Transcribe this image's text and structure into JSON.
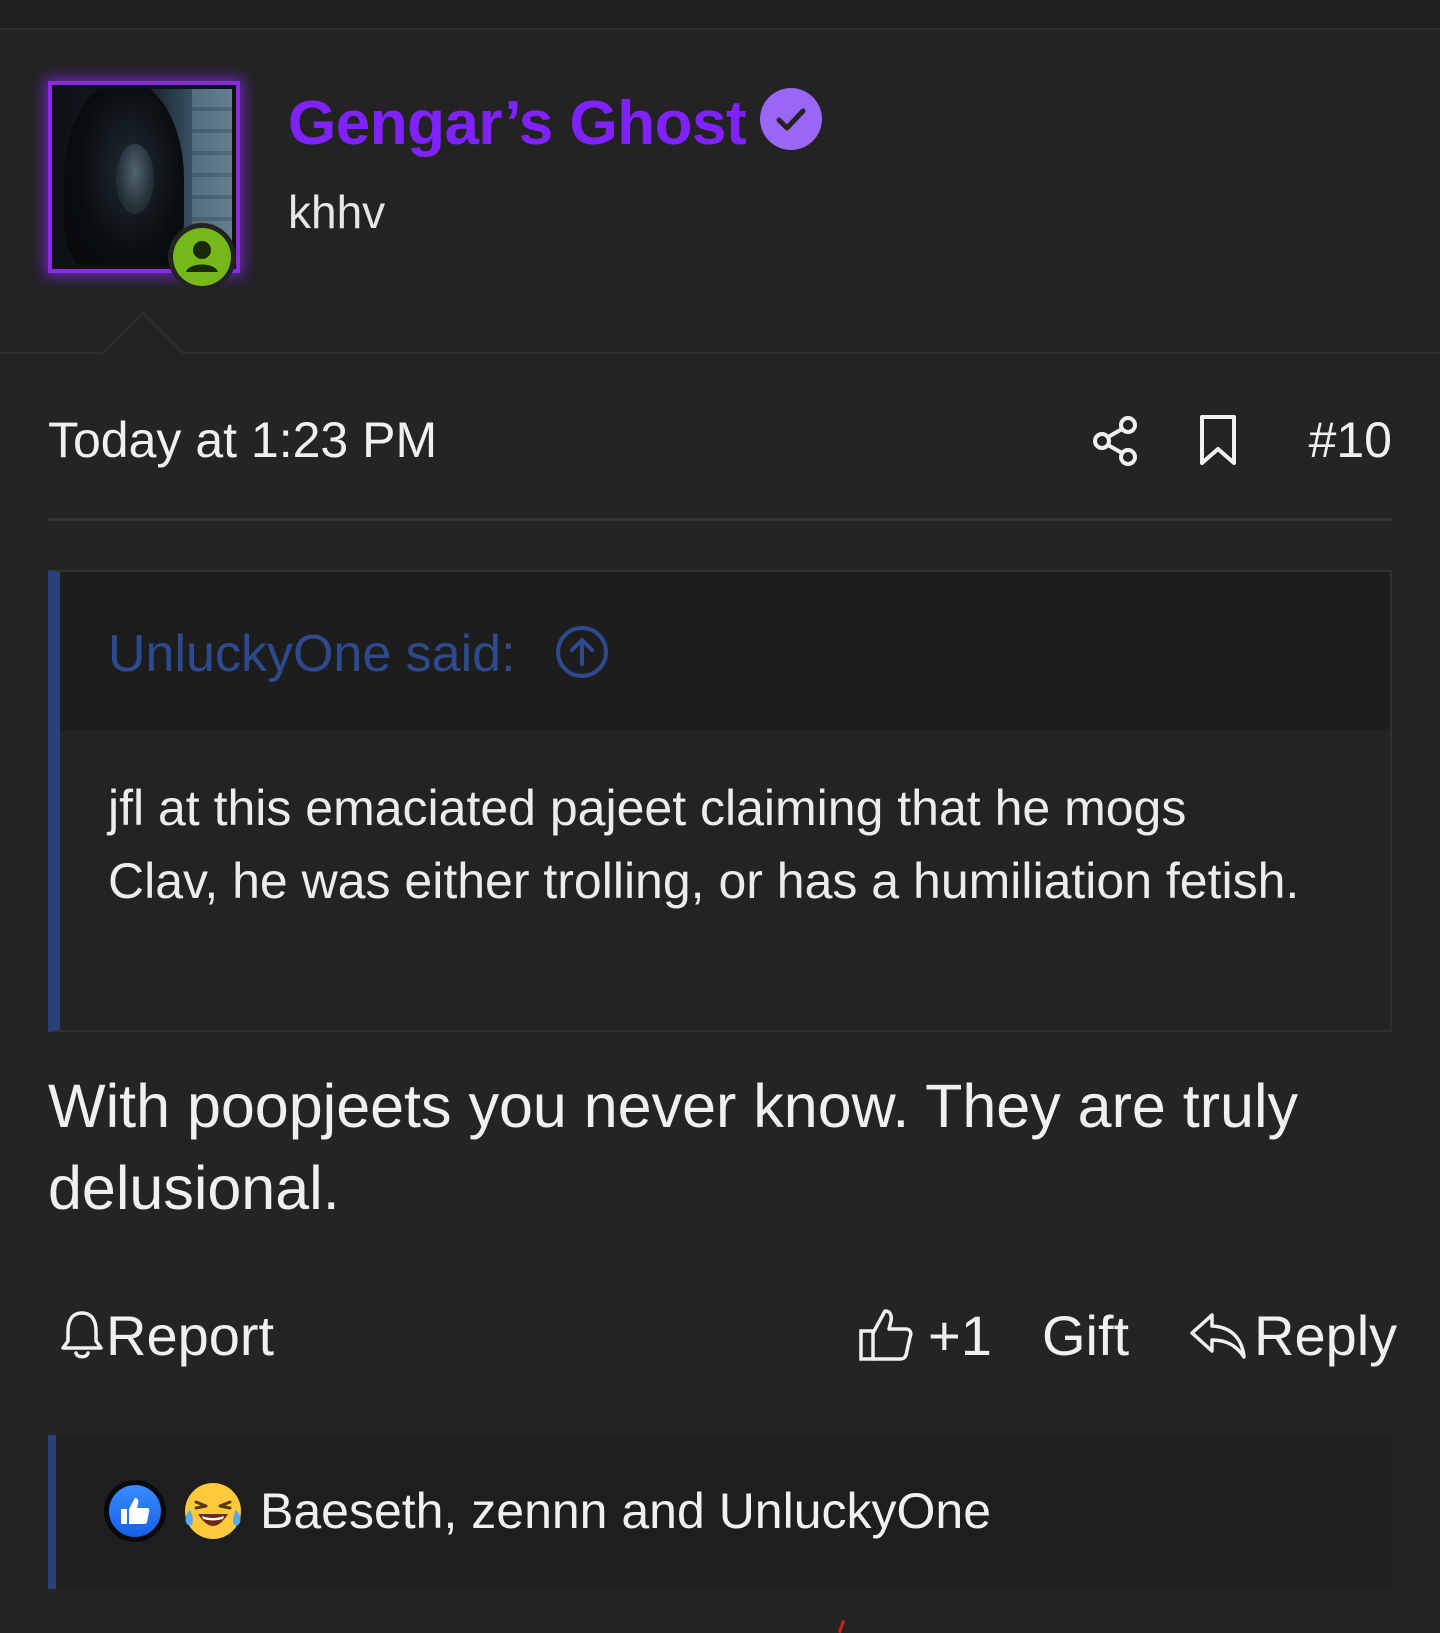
{
  "user": {
    "display_name": "Gengar’s Ghost",
    "title": "khhv",
    "verified": true,
    "online": true,
    "name_color": "#7f22ff",
    "frame_color": "#8a2be2"
  },
  "post": {
    "date": "Today at 1:23 PM",
    "number": "#10",
    "icons": [
      "share-icon",
      "bookmark-icon"
    ],
    "quote": {
      "author_label": "UnluckyOne said:",
      "text": "jfl at this emaciated pajeet claiming that he mogs Clav, he was either trolling, or has a humiliation fetish."
    },
    "body": "With poopjeets you never know. They are truly delusional."
  },
  "actions": {
    "report": "Report",
    "like_count": "+1",
    "gift": "Gift",
    "reply": "Reply"
  },
  "reactions": {
    "icons": [
      "like-reaction-icon",
      "laugh-reaction-icon"
    ],
    "users_text": "Baeseth, zennn and UnluckyOne"
  }
}
